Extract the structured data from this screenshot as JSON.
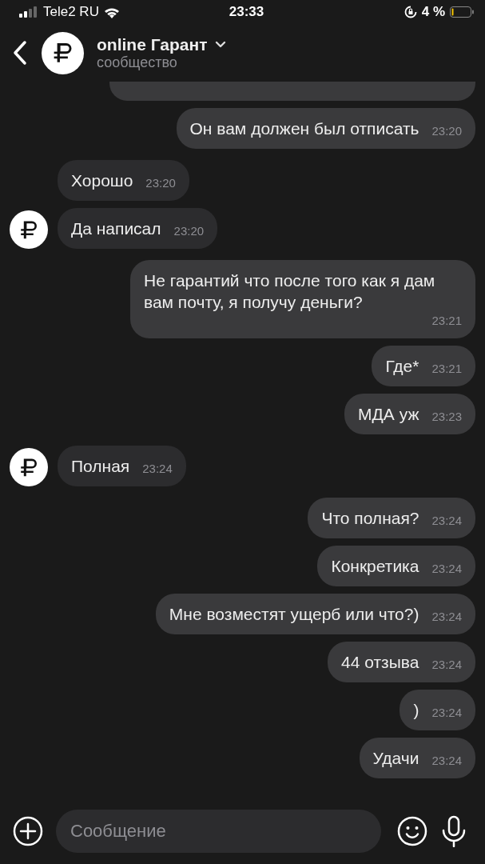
{
  "status_bar": {
    "carrier": "Tele2 RU",
    "time": "23:33",
    "battery": "4 %"
  },
  "header": {
    "title": "online Гарант",
    "subtitle": "сообщество"
  },
  "messages": [
    {
      "kind": "clipped",
      "outgoing": true
    },
    {
      "kind": "text",
      "outgoing": true,
      "text": "Он вам должен был отписать",
      "time": "23:20"
    },
    {
      "kind": "text",
      "outgoing": false,
      "avatar": false,
      "text": "Хорошо",
      "time": "23:20"
    },
    {
      "kind": "text",
      "outgoing": false,
      "avatar": true,
      "text": "Да написал",
      "time": "23:20"
    },
    {
      "kind": "text",
      "outgoing": true,
      "text": "Не гарантий что после того как я дам вам почту, я получу деньги?",
      "time": "23:21"
    },
    {
      "kind": "text",
      "outgoing": true,
      "text": "Где*",
      "time": "23:21"
    },
    {
      "kind": "text",
      "outgoing": true,
      "text": "МДА уж",
      "time": "23:23"
    },
    {
      "kind": "text",
      "outgoing": false,
      "avatar": true,
      "text": "Полная",
      "time": "23:24"
    },
    {
      "kind": "text",
      "outgoing": true,
      "text": "Что полная?",
      "time": "23:24"
    },
    {
      "kind": "text",
      "outgoing": true,
      "text": "Конкретика",
      "time": "23:24"
    },
    {
      "kind": "text",
      "outgoing": true,
      "text": "Мне возместят ущерб или что?)",
      "time": "23:24"
    },
    {
      "kind": "text",
      "outgoing": true,
      "text": "44 отзыва",
      "time": "23:24"
    },
    {
      "kind": "text",
      "outgoing": true,
      "text": ")",
      "time": "23:24"
    },
    {
      "kind": "text",
      "outgoing": true,
      "text": "Удачи",
      "time": "23:24"
    }
  ],
  "composer": {
    "placeholder": "Сообщение"
  }
}
